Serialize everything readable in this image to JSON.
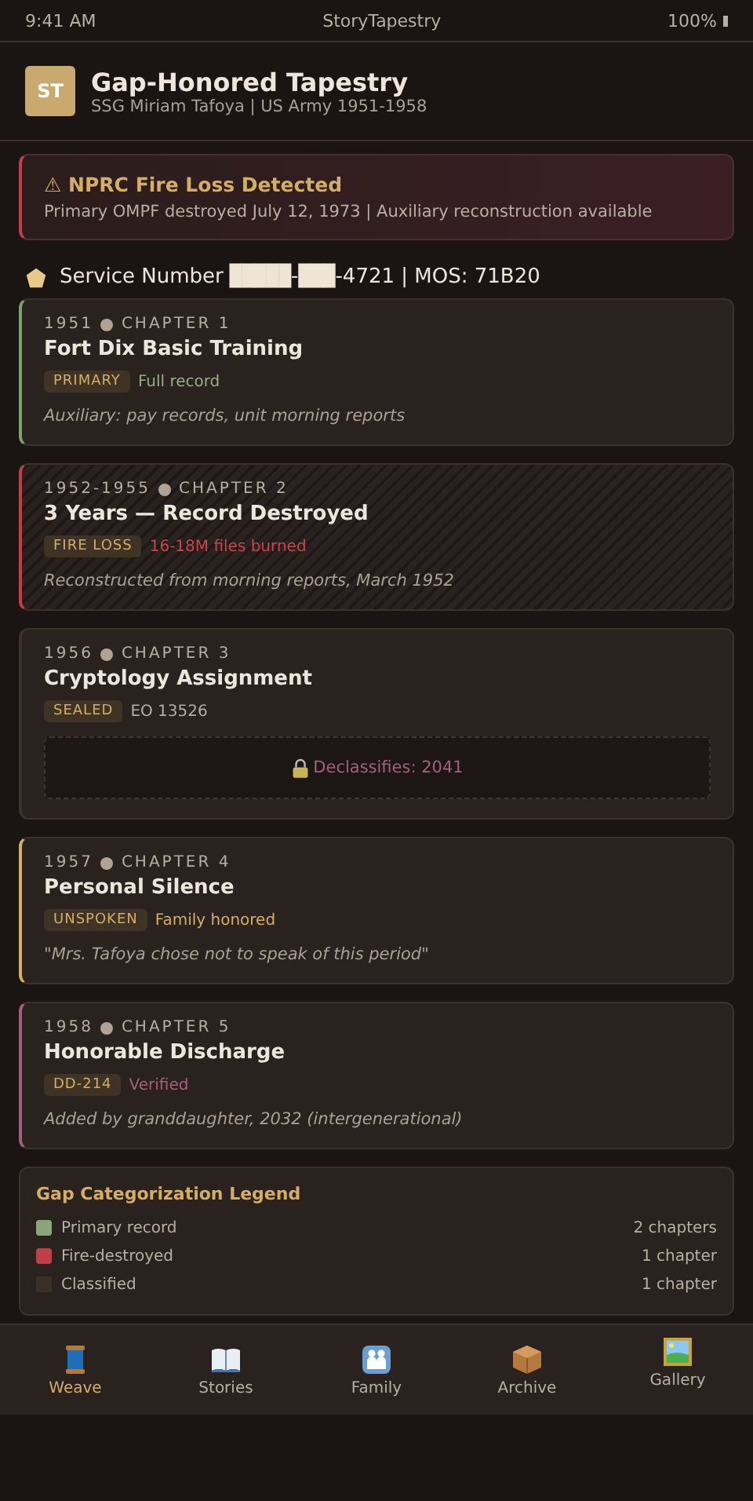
{
  "status_bar": {
    "time": "9:41 AM",
    "app": "StoryTapestry",
    "battery": "100%"
  },
  "header": {
    "logo": "ST",
    "title": "Gap-Honored Tapestry",
    "subtitle": "SSG Miriam Tafoya | US Army 1951-1958"
  },
  "alert": {
    "icon": "⚠",
    "title": "NPRC Fire Loss Detected",
    "text": "Primary OMPF destroyed July 12, 1973 | Auxiliary reconstruction available"
  },
  "service": {
    "parts": [
      {
        "kind": "text",
        "text": "Service Number"
      },
      {
        "kind": "redacted",
        "text": "█████"
      },
      {
        "kind": "text",
        "text": "-"
      },
      {
        "kind": "redacted",
        "text": "███"
      },
      {
        "kind": "text",
        "text": "-4721 | MOS: 71B20"
      }
    ]
  },
  "chapters": [
    {
      "kind": "primary",
      "color": "#7fa06f",
      "years": "1951",
      "chapter": "CHAPTER 1",
      "title": "Fort Dix Basic Training",
      "tag": "PRIMARY",
      "status": "Full record",
      "note": "Auxiliary: pay records, unit morning reports"
    },
    {
      "kind": "fire",
      "color": "#c0404a",
      "years": "1952-1955",
      "chapter": "CHAPTER 2",
      "title": "3 Years — Record Destroyed",
      "tag": "FIRE LOSS",
      "status": "16-18M files burned",
      "note": "Reconstructed from morning reports, March 1952"
    },
    {
      "kind": "sealed",
      "years": "1956",
      "chapter": "CHAPTER 3",
      "title": "Cryptology Assignment",
      "tag": "SEALED",
      "status": "EO 13526",
      "lock_text": "Declassifies: 2041"
    },
    {
      "kind": "unspoken",
      "color": "#d4b06a",
      "years": "1957",
      "chapter": "CHAPTER 4",
      "title": "Personal Silence",
      "tag": "UNSPOKEN",
      "status": "Family honored",
      "note": "\"Mrs. Tafoya chose not to speak of this period\""
    },
    {
      "kind": "verified",
      "color": "#a0607e",
      "years": "1958",
      "chapter": "CHAPTER 5",
      "title": "Honorable Discharge",
      "tag": "DD-214",
      "status": "Verified",
      "note": "Added by granddaughter, 2032 (intergenerational)"
    }
  ],
  "legend": {
    "title": "Gap Categorization Legend",
    "items": [
      {
        "label": "Primary record",
        "count": "2 chapters",
        "color": "#8aa57a"
      },
      {
        "label": "Fire-destroyed",
        "count": "1 chapter",
        "color": "#c0404a"
      },
      {
        "label": "Classified",
        "count": "1 chapter",
        "color": "#3a3028"
      }
    ]
  },
  "tabs": [
    {
      "kind": "spool",
      "label": "Weave",
      "selected": true
    },
    {
      "kind": "book",
      "label": "Stories",
      "selected": false
    },
    {
      "kind": "family",
      "label": "Family",
      "selected": false
    },
    {
      "kind": "box",
      "label": "Archive",
      "selected": false
    },
    {
      "kind": "picture",
      "label": "Gallery",
      "selected": false
    }
  ]
}
